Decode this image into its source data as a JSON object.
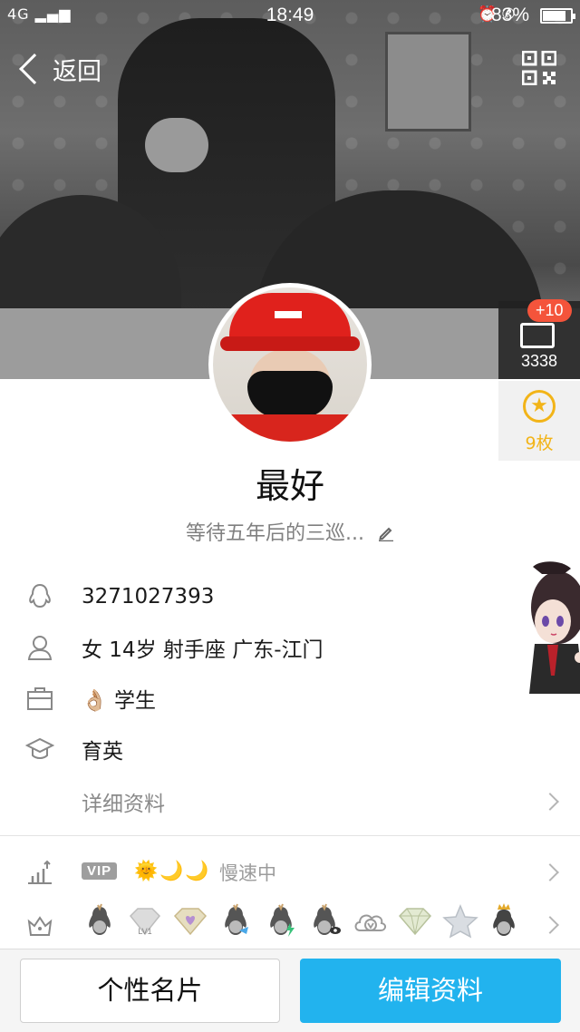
{
  "status_bar": {
    "signal": "4G",
    "time": "18:49",
    "battery": "83%",
    "battery_level": 0.83,
    "icons": [
      "alarm-icon",
      "call-hd-icon"
    ]
  },
  "nav": {
    "back_label": "返回",
    "qr_icon": "qr-code-icon"
  },
  "side": {
    "card_plus": "+10",
    "card_count": "3338",
    "medal_count": "9枚"
  },
  "profile": {
    "nickname": "最好",
    "signature": "等待五年后的三巡..."
  },
  "info": {
    "qq": "3271027393",
    "basic": "女  14岁  射手座  广东-江门",
    "job": "学生",
    "job_emoji": "👌🏼",
    "school": "育英",
    "detail": "详细资料"
  },
  "vip": {
    "badge": "VIP",
    "glyphs": "🌞🌙🌙",
    "status": "慢速中"
  },
  "badges": [
    "penguin-icon",
    "diamond-lv1-icon",
    "heart-diamond-icon",
    "penguin-fish-icon",
    "penguin-bolt-icon",
    "penguin-eye-icon",
    "cloud-v-icon",
    "diamond-icon",
    "star-icon",
    "penguin-crown-icon"
  ],
  "bottom": {
    "card_label": "个性名片",
    "edit_label": "编辑资料"
  },
  "colors": {
    "accent": "#22b3ee",
    "medal": "#f2b418",
    "badge_red": "#f4543b"
  }
}
